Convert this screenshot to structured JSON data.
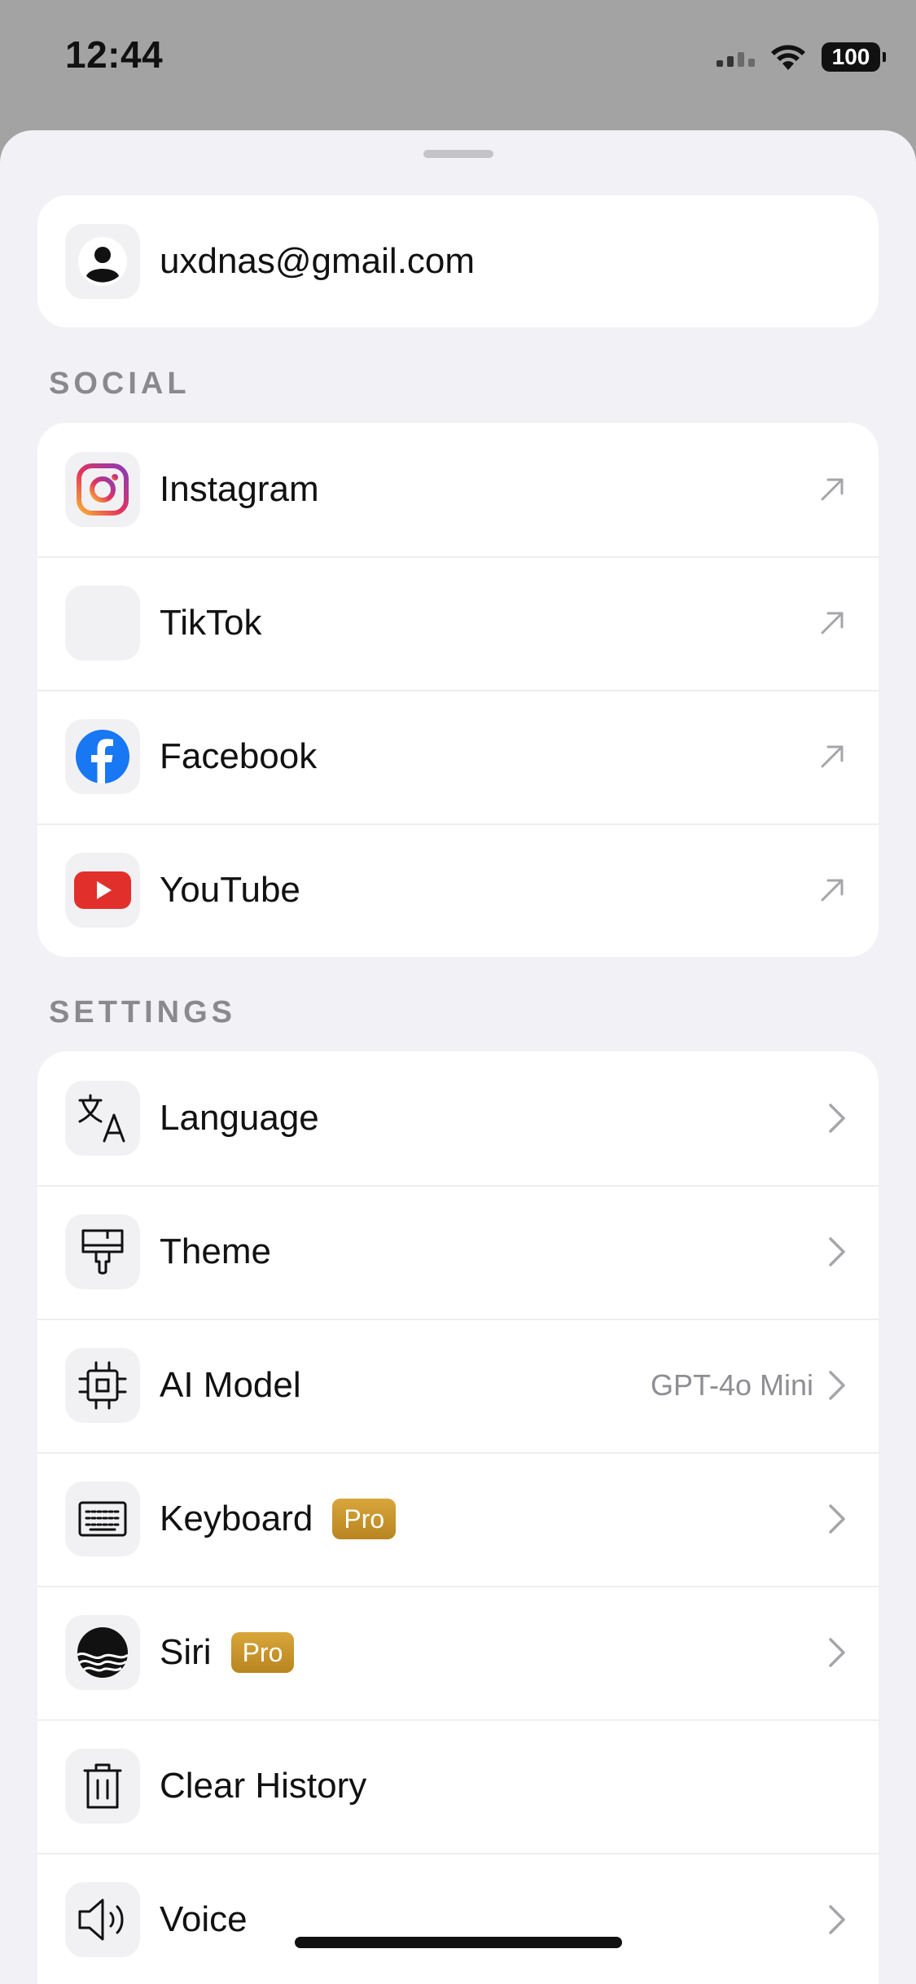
{
  "status_bar": {
    "time": "12:44",
    "battery": "100"
  },
  "account": {
    "email": "uxdnas@gmail.com"
  },
  "social": {
    "title": "SOCIAL",
    "items": [
      {
        "label": "Instagram",
        "icon": "instagram-icon"
      },
      {
        "label": "TikTok",
        "icon": "tiktok-icon"
      },
      {
        "label": "Facebook",
        "icon": "facebook-icon"
      },
      {
        "label": "YouTube",
        "icon": "youtube-icon"
      }
    ]
  },
  "settings": {
    "title": "SETTINGS",
    "items": [
      {
        "label": "Language",
        "icon": "translate-icon"
      },
      {
        "label": "Theme",
        "icon": "paint-brush-icon"
      },
      {
        "label": "AI Model",
        "icon": "chip-icon",
        "value": "GPT-4o Mini"
      },
      {
        "label": "Keyboard",
        "icon": "keyboard-icon",
        "badge": "Pro"
      },
      {
        "label": "Siri",
        "icon": "siri-icon",
        "badge": "Pro"
      },
      {
        "label": "Clear History",
        "icon": "trash-icon"
      },
      {
        "label": "Voice",
        "icon": "speaker-icon"
      }
    ]
  },
  "colors": {
    "sheet_background": "#f1f1f6",
    "card_background": "#ffffff",
    "pro_badge": "#c8952c",
    "facebook_blue": "#1877f2",
    "youtube_red": "#e1302b"
  }
}
